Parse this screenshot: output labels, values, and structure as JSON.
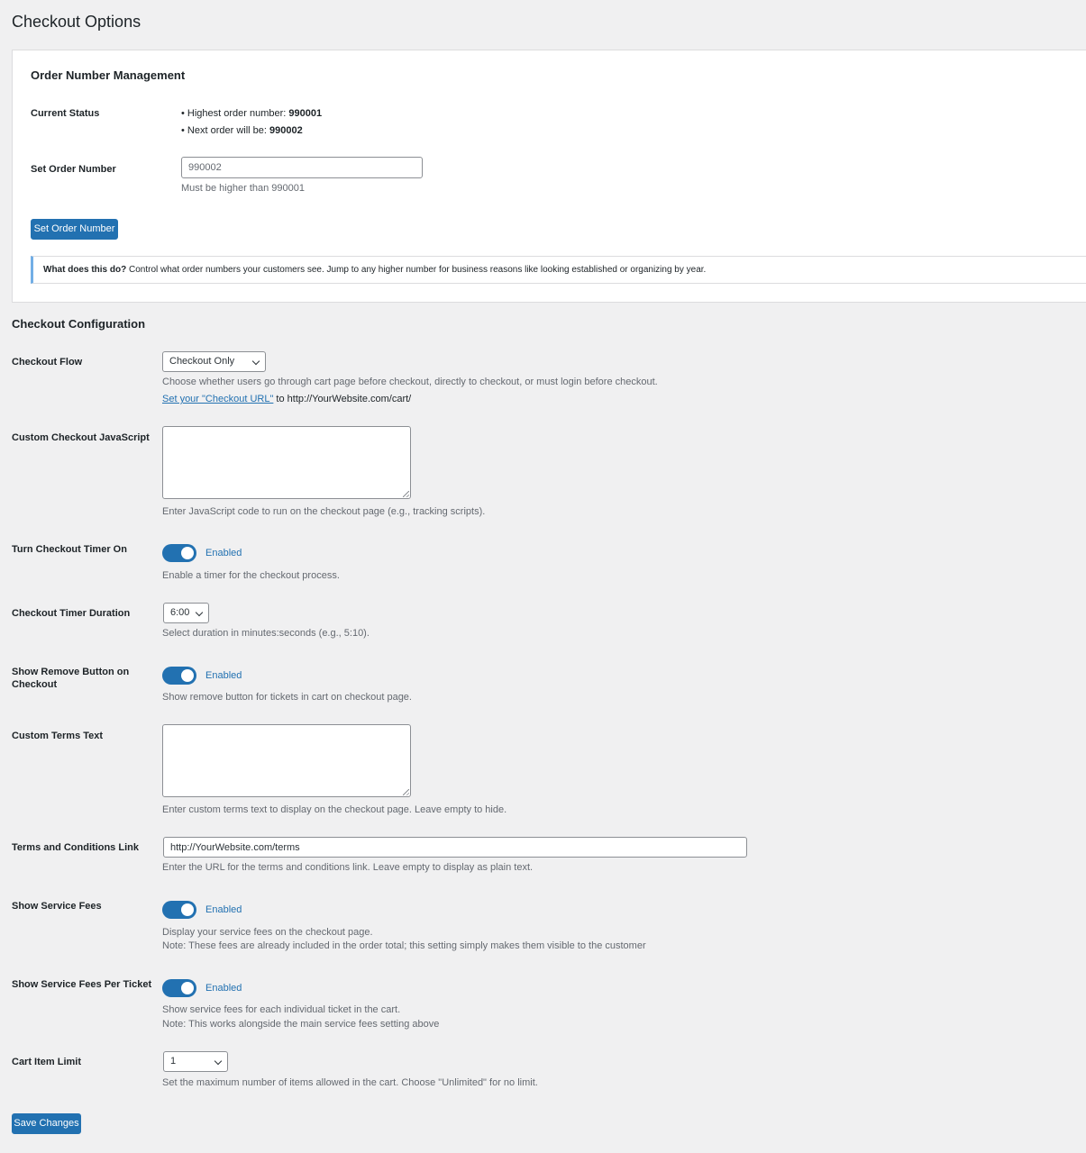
{
  "page": {
    "title": "Checkout Options"
  },
  "order_number": {
    "heading": "Order Number Management",
    "current_status_label": "Current Status",
    "highest_prefix": "• Highest order number: ",
    "highest_value": "990001",
    "next_prefix": "• Next order will be: ",
    "next_value": "990002",
    "set_label": "Set Order Number",
    "set_placeholder": "990002",
    "set_hint": "Must be higher than 990001",
    "button_label": "Set Order Number",
    "notice_bold": "What does this do?",
    "notice_text": " Control what order numbers your customers see. Jump to any higher number for business reasons like looking established or organizing by year."
  },
  "config": {
    "heading": "Checkout Configuration",
    "checkout_flow": {
      "label": "Checkout Flow",
      "value": "Checkout Only",
      "desc": "Choose whether users go through cart page before checkout, directly to checkout, or must login before checkout.",
      "link_text": "Set your \"Checkout URL\"",
      "link_suffix": " to http://YourWebsite.com/cart/"
    },
    "custom_js": {
      "label": "Custom Checkout JavaScript",
      "value": "",
      "desc": "Enter JavaScript code to run on the checkout page (e.g., tracking scripts)."
    },
    "timer_on": {
      "label": "Turn Checkout Timer On",
      "state": "Enabled",
      "desc": "Enable a timer for the checkout process."
    },
    "timer_duration": {
      "label": "Checkout Timer Duration",
      "value": "6:00",
      "desc": "Select duration in minutes:seconds (e.g., 5:10)."
    },
    "remove_button": {
      "label_line1": "Show Remove Button on",
      "label_line2": "Checkout",
      "state": "Enabled",
      "desc": "Show remove button for tickets in cart on checkout page."
    },
    "terms_text": {
      "label": "Custom Terms Text",
      "value": "",
      "desc": "Enter custom terms text to display on the checkout page. Leave empty to hide."
    },
    "terms_link": {
      "label": "Terms and Conditions Link",
      "value": "http://YourWebsite.com/terms",
      "desc": "Enter the URL for the terms and conditions link. Leave empty to display as plain text."
    },
    "service_fees": {
      "label": "Show Service Fees",
      "state": "Enabled",
      "desc1": "Display your service fees on the checkout page.",
      "desc2": "Note: These fees are already included in the order total; this setting simply makes them visible to the customer"
    },
    "service_fees_per_ticket": {
      "label": "Show Service Fees Per Ticket",
      "state": "Enabled",
      "desc1": "Show service fees for each individual ticket in the cart.",
      "desc2": "Note: This works alongside the main service fees setting above"
    },
    "cart_limit": {
      "label": "Cart Item Limit",
      "value": "1",
      "desc": "Set the maximum number of items allowed in the cart. Choose \"Unlimited\" for no limit."
    },
    "save_label": "Save Changes"
  },
  "colors": {
    "accent": "#2271b1",
    "background": "#f0f0f1",
    "notice_border": "#72aee6"
  }
}
